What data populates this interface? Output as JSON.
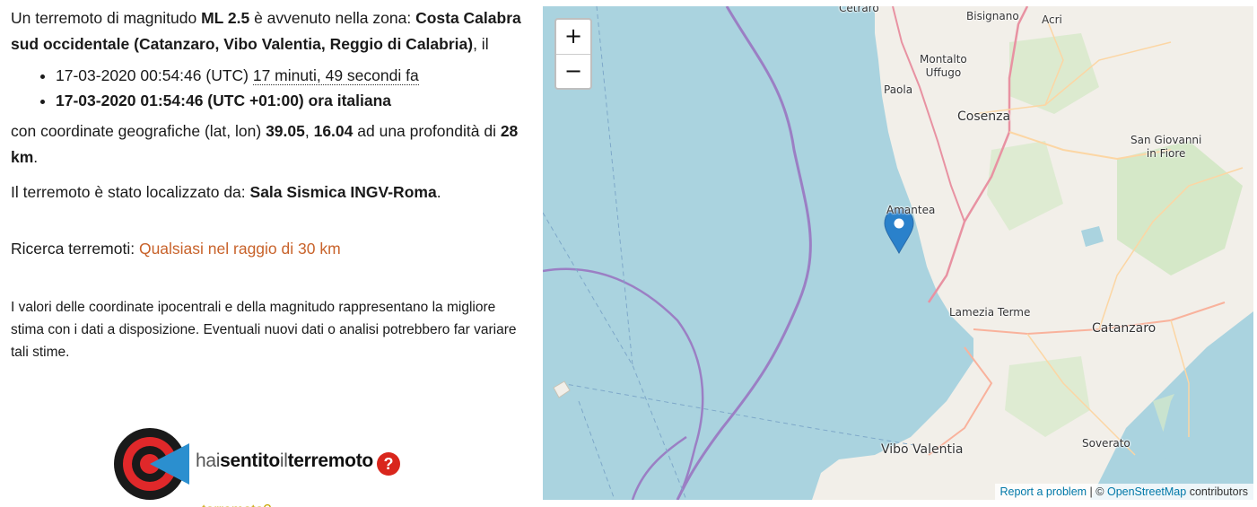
{
  "quake": {
    "intro_prefix": "Un terremoto di magnitudo ",
    "magnitude": "ML 2.5",
    "intro_mid": " è avvenuto nella zona: ",
    "zone": "Costa Calabra sud occidentale (Catanzaro, Vibo Valentia, Reggio di Calabria)",
    "intro_suffix": ", il",
    "time_utc": "17-03-2020 00:54:46 (UTC)",
    "time_ago": "17 minuti, 49 secondi fa",
    "time_local": "17-03-2020 01:54:46 (UTC +01:00) ora italiana",
    "coords_prefix": "con coordinate geografiche (lat, lon) ",
    "lat": "39.05",
    "coords_sep": ", ",
    "lon": "16.04",
    "depth_prefix": " ad una profondità di ",
    "depth": "28 km",
    "period": ".",
    "located_prefix": "Il terremoto è stato localizzato da: ",
    "located_by": "Sala Sismica INGV-Roma",
    "search_label": "Ricerca terremoti: ",
    "search_link": "Qualsiasi nel raggio di 30 km",
    "note": "I valori delle coordinate ipocentrali e della magnitudo rappresentano la migliore stima con i dati a disposizione. Eventuali nuovi dati o analisi potrebbero far variare tali stime."
  },
  "hst": {
    "part1": "hai",
    "part2": "sentito",
    "part3": "il",
    "part4": "terremoto",
    "qmark": "?",
    "cut_text": "Hai sentito il terremoto?"
  },
  "map": {
    "zoom_in": "+",
    "zoom_out": "−",
    "attrib_report": "Report a problem",
    "attrib_sep": " | © ",
    "attrib_osm": "OpenStreetMap",
    "attrib_suffix": " contributors",
    "labels": {
      "cetraro": "Cetraro",
      "bisignano": "Bisignano",
      "acri": "Acri",
      "montalto": "Montalto\nUffugo",
      "paola": "Paola",
      "cosenza": "Cosenza",
      "sangiovanni": "San Giovanni\nin Fiore",
      "amantea": "Amantea",
      "lamezia": "Lamezia Terme",
      "catanzaro": "Catanzaro",
      "vibo": "Vibo Valentia",
      "soverato": "Soverato"
    },
    "colors": {
      "sea": "#aad3df",
      "land": "#f2efe9",
      "marker": "#2a81cb",
      "plate": "#9b7fc4"
    }
  }
}
